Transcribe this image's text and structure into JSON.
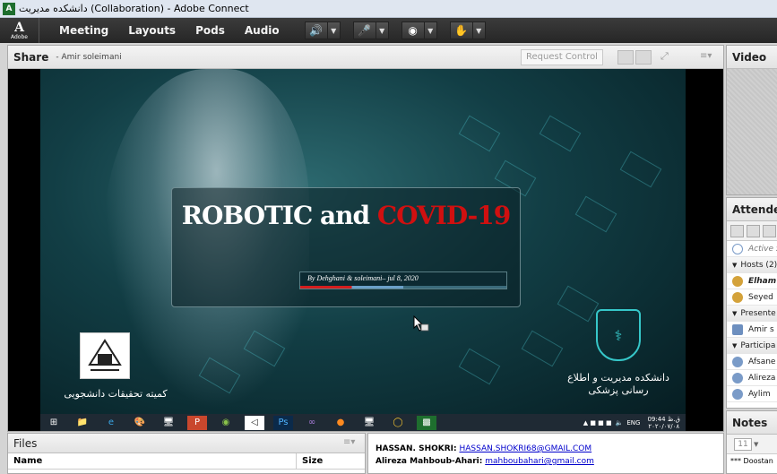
{
  "window": {
    "title": "دانشکده مدیریت (Collaboration) - Adobe Connect",
    "app_icon": "adobe-connect-icon"
  },
  "menubar": {
    "logo": {
      "letter": "A",
      "sub": "Adobe"
    },
    "items": [
      "Meeting",
      "Layouts",
      "Pods",
      "Audio"
    ],
    "toolbar_icons": [
      "speaker-icon",
      "microphone-icon",
      "webcam-icon",
      "raise-hand-icon"
    ]
  },
  "share_pod": {
    "title": "Share",
    "presenter": "- Amir soleimani",
    "request_control": "Request Control",
    "menu_icon": "pod-menu-icon"
  },
  "slide": {
    "title_white": "ROBOTIC and",
    "title_red": "COVID-19",
    "byline": "By Dehghani & soleimani– jul 8, 2020",
    "left_logo_text": "کمیته تحقیقات دانشجویی",
    "right_logo_text_1": "دانشکده مدیریت و اطلاع",
    "right_logo_text_2": "رسانی پزشکی",
    "accent_red": "#d01010",
    "accent_teal": "#36c7c9"
  },
  "taskbar": {
    "icons": [
      "windows-start-icon",
      "file-explorer-icon",
      "internet-explorer-icon",
      "paint-icon",
      "powerpoint-icon",
      "android-icon",
      "visual-studio-code-icon",
      "photoshop-icon",
      "visual-studio-icon",
      "firefox-icon",
      "remote-desktop-icon",
      "chrome-icon",
      "adobe-connect-icon"
    ],
    "lang": "ENG",
    "time": "09:44 ق.ظ",
    "date": "۲۰۲۰/۰۷/۰۸"
  },
  "video_pod": {
    "title": "Video"
  },
  "attendees_pod": {
    "title": "Attendees",
    "status": "Active S",
    "groups": [
      {
        "label": "Hosts (2)",
        "members": [
          "Elham",
          "Seyed"
        ]
      },
      {
        "label": "Presente",
        "members": [
          "Amir s"
        ]
      },
      {
        "label": "Participa",
        "members": [
          "Afsane",
          "Alireza",
          "Aylim"
        ]
      }
    ]
  },
  "notes_pod": {
    "title": "Notes",
    "font_size": "11",
    "text": "*** Doostan"
  },
  "files_pod": {
    "title": "Files",
    "col_name": "Name",
    "col_size": "Size"
  },
  "chat": {
    "lines": [
      {
        "name": "HASSAN. SHOKRI:",
        "email": "HASSAN.SHOKRI68@GMAIL.COM"
      },
      {
        "name": "Alireza Mahboub-Ahari:",
        "email": "mahboubahari@gmail.com"
      }
    ]
  }
}
